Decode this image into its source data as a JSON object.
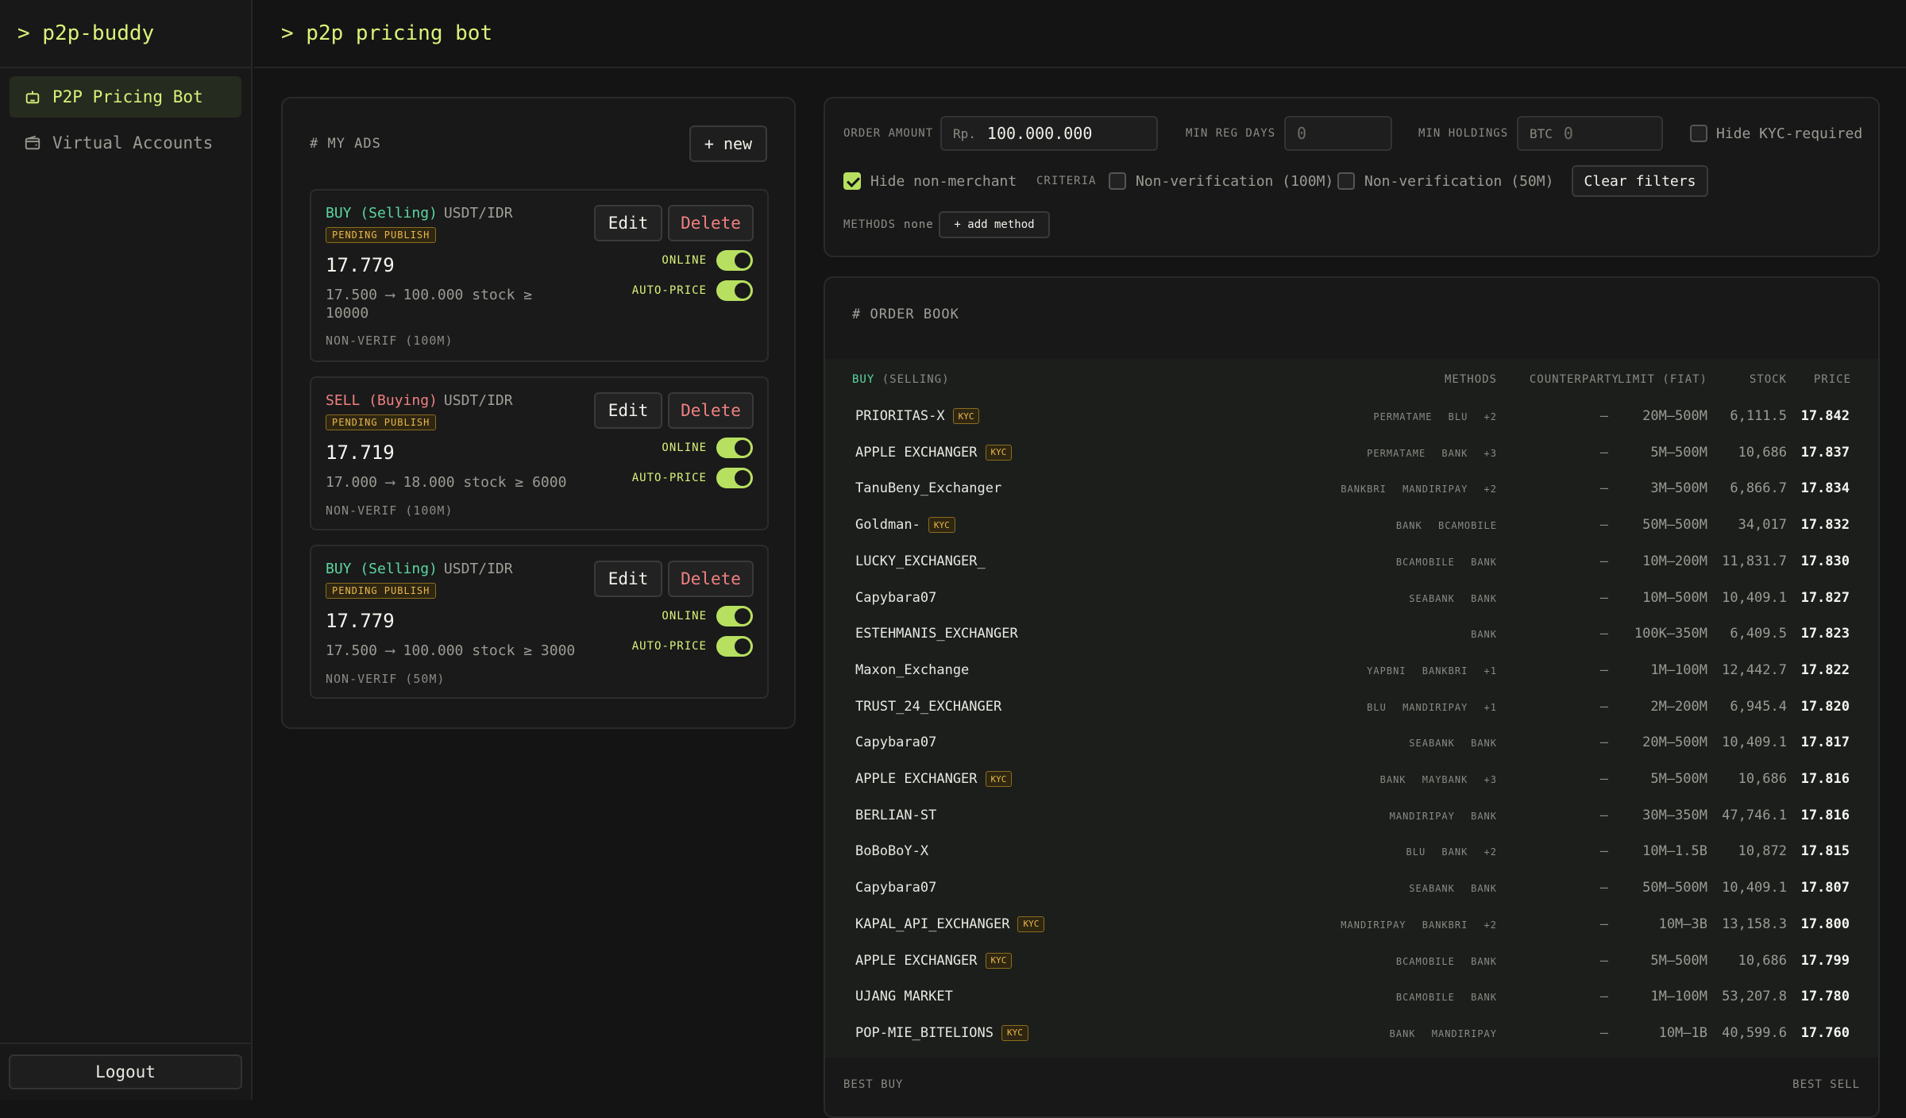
{
  "app": {
    "brand": "> p2p-buddy",
    "page_title": "> p2p pricing bot"
  },
  "sidebar": {
    "items": [
      {
        "label": "P2P Pricing Bot",
        "icon": "bot-icon",
        "active": true
      },
      {
        "label": "Virtual Accounts",
        "icon": "wallet-icon",
        "active": false
      }
    ],
    "logout_label": "Logout"
  },
  "my_ads": {
    "title": "# MY ADS",
    "new_label": "+ new",
    "edit_label": "Edit",
    "delete_label": "Delete",
    "online_label": "ONLINE",
    "autoprice_label": "AUTO-PRICE",
    "ads": [
      {
        "side": "BUY (Selling)",
        "pair": "USDT/IDR",
        "status": "PENDING PUBLISH",
        "price": "17.779",
        "range": "17.500 ⟶ 100.000 stock ≥ 10000",
        "criteria": "NON-VERIF (100M)",
        "online": true,
        "auto_price": true
      },
      {
        "side": "SELL (Buying)",
        "pair": "USDT/IDR",
        "status": "PENDING PUBLISH",
        "price": "17.719",
        "range": "17.000 ⟶ 18.000 stock ≥ 6000",
        "criteria": "NON-VERIF (100M)",
        "online": true,
        "auto_price": true
      },
      {
        "side": "BUY (Selling)",
        "pair": "USDT/IDR",
        "status": "PENDING PUBLISH",
        "price": "17.779",
        "range": "17.500 ⟶ 100.000 stock ≥ 3000",
        "criteria": "NON-VERIF (50M)",
        "online": true,
        "auto_price": true
      }
    ]
  },
  "filters": {
    "order_amount_label": "ORDER AMOUNT",
    "order_amount_prefix": "Rp.",
    "order_amount_value": "100.000.000",
    "min_reg_days_label": "MIN REG DAYS",
    "min_reg_days_placeholder": "0",
    "min_holdings_label": "MIN HOLDINGS",
    "min_holdings_prefix": "BTC",
    "min_holdings_placeholder": "0",
    "hide_kyc_label": "Hide KYC-required",
    "hide_kyc_checked": false,
    "hide_nonmerchant_label": "Hide non-merchant",
    "hide_nonmerchant_checked": true,
    "criteria_label": "CRITERIA",
    "criteria_options": [
      {
        "label": "Non-verification (100M)",
        "checked": false
      },
      {
        "label": "Non-verification (50M)",
        "checked": false
      }
    ],
    "clear_label": "Clear filters",
    "methods_label": "METHODS",
    "methods_value": "none",
    "add_method_label": "+ add method"
  },
  "order_book": {
    "title": "# ORDER BOOK",
    "side_label": "BUY",
    "side_sub": "(SELLING)",
    "columns": {
      "methods": "METHODS",
      "counterparty": "COUNTERPARTY",
      "limit": "LIMIT (FIAT)",
      "stock": "STOCK",
      "price": "PRICE"
    },
    "rows": [
      {
        "name": "PRIORITAS-X",
        "kyc": true,
        "methods": "PERMATAME BLU +2",
        "counterparty": "–",
        "limit": "20M–500M",
        "stock": "6,111.5",
        "price": "17.842"
      },
      {
        "name": "APPLE EXCHANGER",
        "kyc": true,
        "methods": "PERMATAME BANK +3",
        "counterparty": "–",
        "limit": "5M–500M",
        "stock": "10,686",
        "price": "17.837"
      },
      {
        "name": "TanuBeny_Exchanger",
        "kyc": false,
        "methods": "BANKBRI MANDIRIPAY +2",
        "counterparty": "–",
        "limit": "3M–500M",
        "stock": "6,866.7",
        "price": "17.834"
      },
      {
        "name": "Goldman-",
        "kyc": true,
        "methods": "BANK BCAMOBILE",
        "counterparty": "–",
        "limit": "50M–500M",
        "stock": "34,017",
        "price": "17.832"
      },
      {
        "name": "LUCKY_EXCHANGER_",
        "kyc": false,
        "methods": "BCAMOBILE BANK",
        "counterparty": "–",
        "limit": "10M–200M",
        "stock": "11,831.7",
        "price": "17.830"
      },
      {
        "name": "Capybara07",
        "kyc": false,
        "methods": "SEABANK BANK",
        "counterparty": "–",
        "limit": "10M–500M",
        "stock": "10,409.1",
        "price": "17.827"
      },
      {
        "name": "ESTEHMANIS_EXCHANGER",
        "kyc": false,
        "methods": "BANK",
        "counterparty": "–",
        "limit": "100K–350M",
        "stock": "6,409.5",
        "price": "17.823"
      },
      {
        "name": "Maxon_Exchange",
        "kyc": false,
        "methods": "YAPBNI BANKBRI +1",
        "counterparty": "–",
        "limit": "1M–100M",
        "stock": "12,442.7",
        "price": "17.822"
      },
      {
        "name": "TRUST_24_EXCHANGER",
        "kyc": false,
        "methods": "BLU MANDIRIPAY +1",
        "counterparty": "–",
        "limit": "2M–200M",
        "stock": "6,945.4",
        "price": "17.820"
      },
      {
        "name": "Capybara07",
        "kyc": false,
        "methods": "SEABANK BANK",
        "counterparty": "–",
        "limit": "20M–500M",
        "stock": "10,409.1",
        "price": "17.817"
      },
      {
        "name": "APPLE EXCHANGER",
        "kyc": true,
        "methods": "BANK MAYBANK +3",
        "counterparty": "–",
        "limit": "5M–500M",
        "stock": "10,686",
        "price": "17.816"
      },
      {
        "name": "BERLIAN-ST",
        "kyc": false,
        "methods": "MANDIRIPAY BANK",
        "counterparty": "–",
        "limit": "30M–350M",
        "stock": "47,746.1",
        "price": "17.816"
      },
      {
        "name": "BoBoBoY-X",
        "kyc": false,
        "methods": "BLU BANK +2",
        "counterparty": "–",
        "limit": "10M–1.5B",
        "stock": "10,872",
        "price": "17.815"
      },
      {
        "name": "Capybara07",
        "kyc": false,
        "methods": "SEABANK BANK",
        "counterparty": "–",
        "limit": "50M–500M",
        "stock": "10,409.1",
        "price": "17.807"
      },
      {
        "name": "KAPAL_API_EXCHANGER",
        "kyc": true,
        "methods": "MANDIRIPAY BANKBRI +2",
        "counterparty": "–",
        "limit": "10M–3B",
        "stock": "13,158.3",
        "price": "17.800"
      },
      {
        "name": "APPLE EXCHANGER",
        "kyc": true,
        "methods": "BCAMOBILE BANK",
        "counterparty": "–",
        "limit": "5M–500M",
        "stock": "10,686",
        "price": "17.799"
      },
      {
        "name": "UJANG MARKET",
        "kyc": false,
        "methods": "BCAMOBILE BANK",
        "counterparty": "–",
        "limit": "1M–100M",
        "stock": "53,207.8",
        "price": "17.780"
      },
      {
        "name": "POP-MIE_BITELIONS",
        "kyc": true,
        "methods": "BANK MANDIRIPAY",
        "counterparty": "–",
        "limit": "10M–1B",
        "stock": "40,599.6",
        "price": "17.760"
      }
    ],
    "kyc_label": "KYC",
    "best_buy_label": "BEST BUY",
    "best_sell_label": "BEST SELL"
  },
  "colors": {
    "accent": "#d9f27a",
    "buy": "#5cd6a1",
    "sell": "#f08080",
    "badge": "#e8b84a",
    "toggle_on": "#b7e060"
  }
}
